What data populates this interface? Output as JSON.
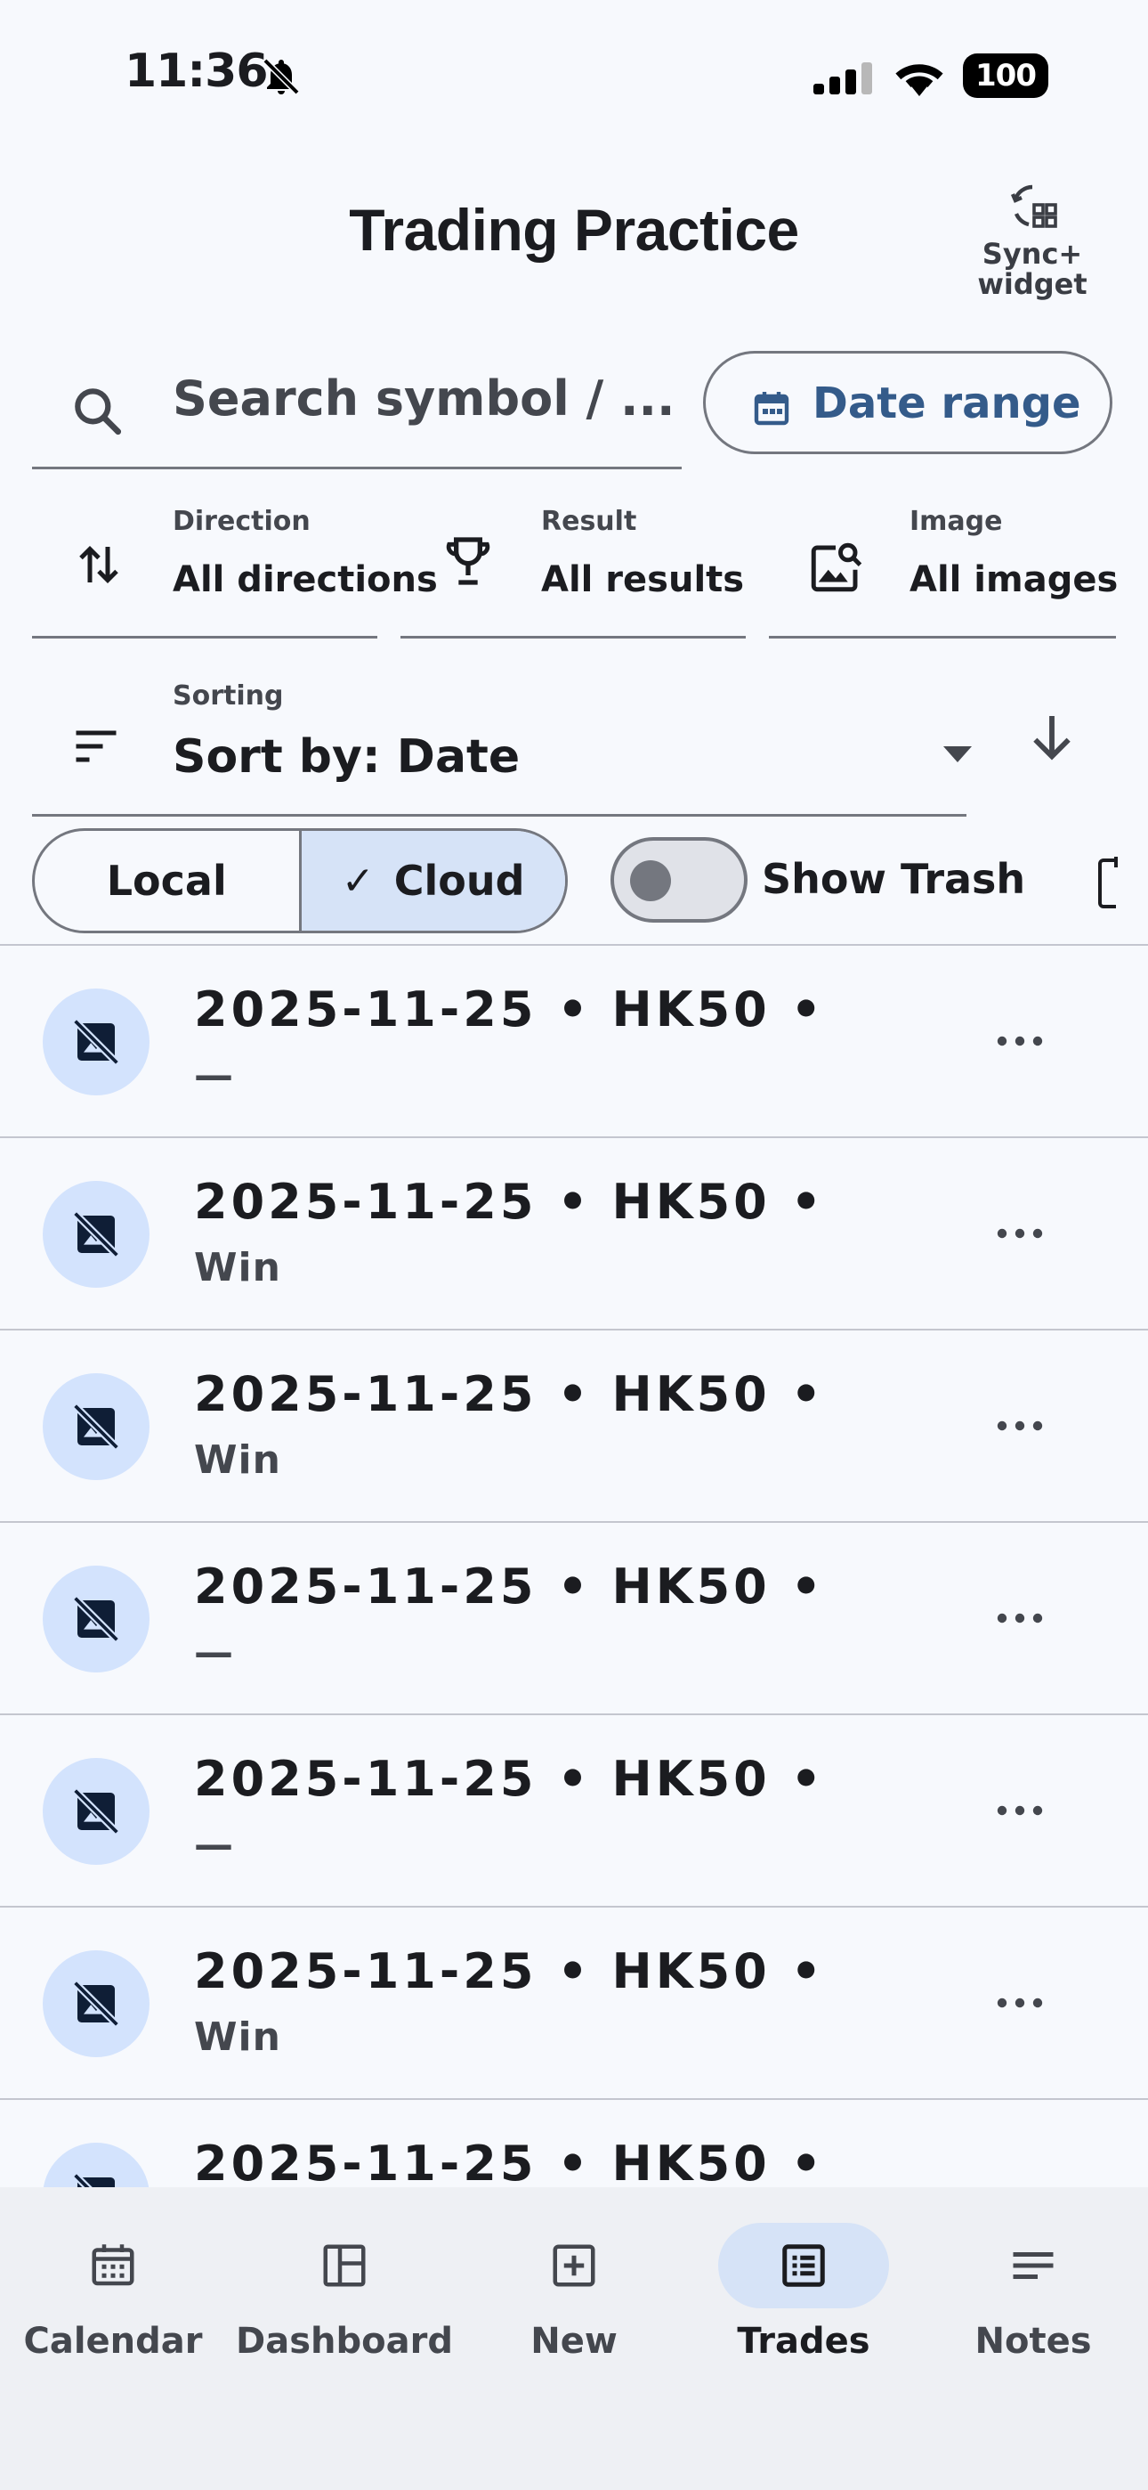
{
  "status_bar": {
    "time": "11:36",
    "battery": "100"
  },
  "header": {
    "title": "Trading Practice",
    "sync_label": "Sync+\nwidget"
  },
  "search": {
    "placeholder": "Search symbol / ...",
    "date_range_label": "Date range"
  },
  "filters": [
    {
      "label": "Direction",
      "value": "All directions",
      "icon": "swap-vert-icon"
    },
    {
      "label": "Result",
      "value": "All results",
      "icon": "trophy-icon"
    },
    {
      "label": "Image",
      "value": "All images",
      "icon": "image-search-icon"
    }
  ],
  "sorting": {
    "label": "Sorting",
    "value": "Sort by: Date"
  },
  "source_toggle": {
    "local": "Local",
    "cloud": "Cloud",
    "selected": "cloud",
    "cloud_check": "✓"
  },
  "trash": {
    "label": "Show Trash",
    "enabled": false
  },
  "trades": [
    {
      "title": "2025-11-25 • HK50 •",
      "result": "—"
    },
    {
      "title": "2025-11-25 • HK50 •",
      "result": "Win"
    },
    {
      "title": "2025-11-25 • HK50 •",
      "result": "Win"
    },
    {
      "title": "2025-11-25 • HK50 •",
      "result": "—"
    },
    {
      "title": "2025-11-25 • HK50 •",
      "result": "—"
    },
    {
      "title": "2025-11-25 • HK50 •",
      "result": "Win"
    },
    {
      "title": "2025-11-25 • HK50 •",
      "result": ""
    }
  ],
  "nav": [
    {
      "label": "Calendar",
      "icon": "calendar-icon",
      "active": false
    },
    {
      "label": "Dashboard",
      "icon": "dashboard-icon",
      "active": false
    },
    {
      "label": "New",
      "icon": "add-box-icon",
      "active": false
    },
    {
      "label": "Trades",
      "icon": "list-alt-icon",
      "active": true
    },
    {
      "label": "Notes",
      "icon": "notes-icon",
      "active": false
    }
  ],
  "colors": {
    "accent": "#345b8a",
    "selected_bg": "#d6e3f7",
    "avatar_bg": "#d3e3fd",
    "background": "#f7f9fd"
  }
}
